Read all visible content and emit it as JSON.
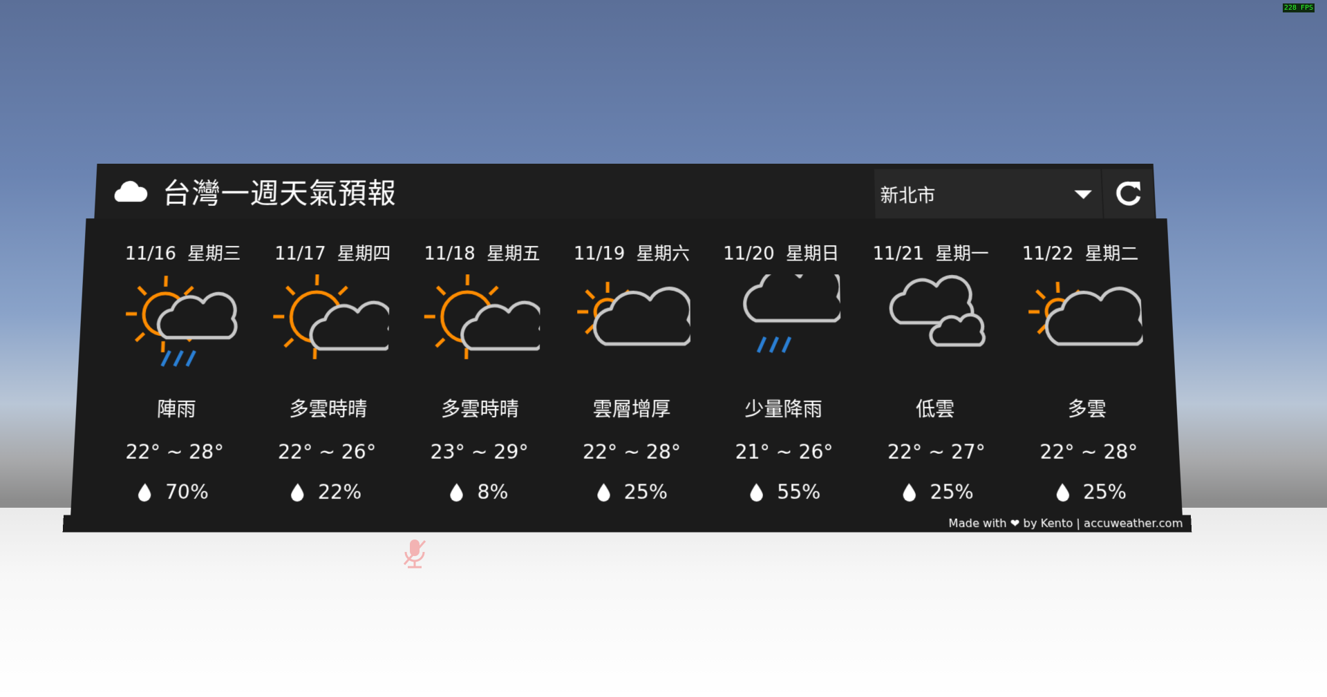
{
  "app": {
    "title": "台灣一週天氣預報",
    "city": "新北市",
    "fps": "228 FPS",
    "footer": "Made with ❤ by Kento | accuweather.com"
  },
  "colors": {
    "panel": "#1b1b1b",
    "header": "#1e1e1e",
    "sun": "#ff8c00",
    "cloud": "#c8c8c8",
    "rain": "#2a7fd4"
  },
  "forecast": [
    {
      "date": "11/16  星期三",
      "icon": "sun-cloud-rain-icon",
      "desc": "陣雨",
      "temp": "22° ~ 28°",
      "rain": "70%"
    },
    {
      "date": "11/17  星期四",
      "icon": "partly-sunny-icon",
      "desc": "多雲時晴",
      "temp": "22° ~ 26°",
      "rain": "22%"
    },
    {
      "date": "11/18  星期五",
      "icon": "partly-sunny-icon",
      "desc": "多雲時晴",
      "temp": "23° ~ 29°",
      "rain": "8%"
    },
    {
      "date": "11/19  星期六",
      "icon": "mostly-cloudy-sun-icon",
      "desc": "雲層增厚",
      "temp": "22° ~ 28°",
      "rain": "25%"
    },
    {
      "date": "11/20  星期日",
      "icon": "cloud-rain-icon",
      "desc": "少量降雨",
      "temp": "21° ~ 26°",
      "rain": "55%"
    },
    {
      "date": "11/21  星期一",
      "icon": "cloudy-icon",
      "desc": "低雲",
      "temp": "22° ~ 27°",
      "rain": "25%"
    },
    {
      "date": "11/22  星期二",
      "icon": "mostly-cloudy-sun-icon",
      "desc": "多雲",
      "temp": "22° ~ 28°",
      "rain": "25%"
    }
  ]
}
